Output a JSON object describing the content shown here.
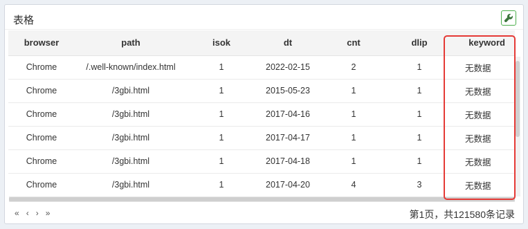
{
  "panel": {
    "title": "表格"
  },
  "table": {
    "headers": [
      "browser",
      "path",
      "isok",
      "dt",
      "cnt",
      "dlip",
      "keyword"
    ],
    "rows": [
      [
        "Chrome",
        "/.well-known/index.html",
        "1",
        "2022-02-15",
        "2",
        "1",
        "无数据"
      ],
      [
        "Chrome",
        "/3gbi.html",
        "1",
        "2015-05-23",
        "1",
        "1",
        "无数据"
      ],
      [
        "Chrome",
        "/3gbi.html",
        "1",
        "2017-04-16",
        "1",
        "1",
        "无数据"
      ],
      [
        "Chrome",
        "/3gbi.html",
        "1",
        "2017-04-17",
        "1",
        "1",
        "无数据"
      ],
      [
        "Chrome",
        "/3gbi.html",
        "1",
        "2017-04-18",
        "1",
        "1",
        "无数据"
      ],
      [
        "Chrome",
        "/3gbi.html",
        "1",
        "2017-04-20",
        "4",
        "3",
        "无数据"
      ]
    ]
  },
  "pager": {
    "first": "«",
    "prev": "‹",
    "next": "›",
    "last": "»",
    "info": "第1页，共121580条记录"
  },
  "colors": {
    "highlight": "#e53935",
    "tool_border": "#4cae4c"
  },
  "icons": {
    "tool": "wrench-icon"
  }
}
